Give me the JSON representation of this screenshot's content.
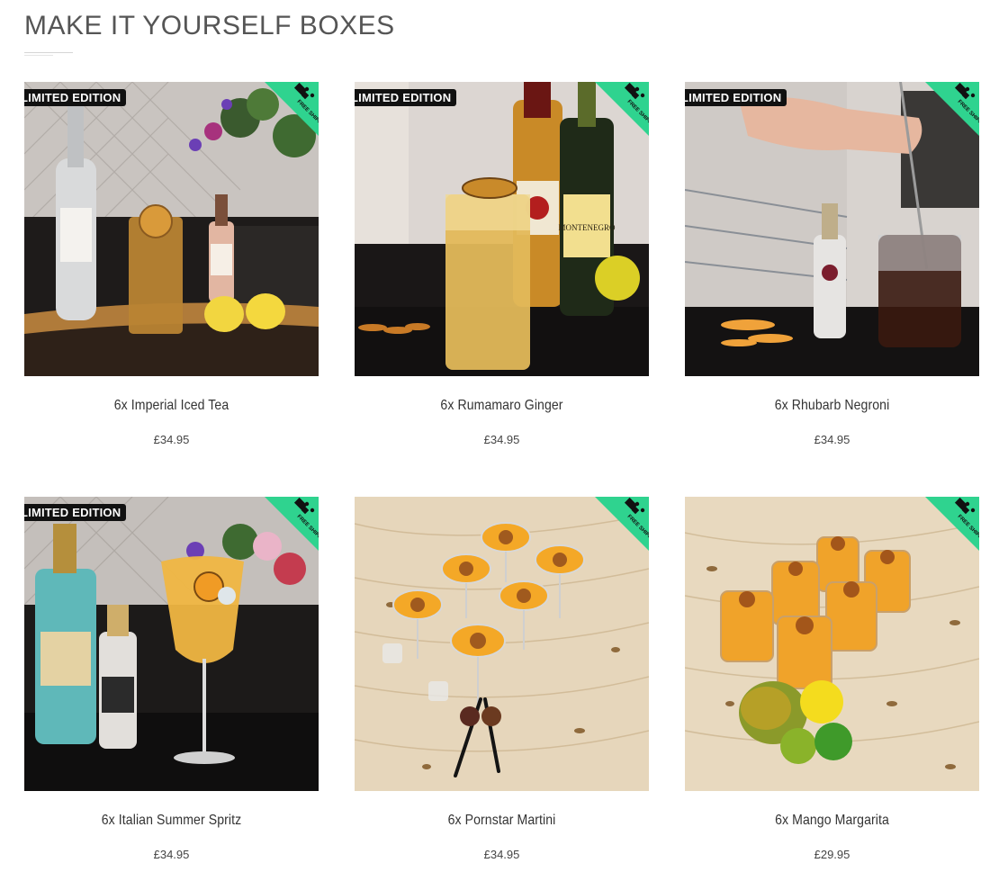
{
  "section": {
    "title": "MAKE IT YOURSELF BOXES"
  },
  "badges": {
    "limited": "LIMITED EDITION",
    "free_shipping": "FREE SHIPPING"
  },
  "products": [
    {
      "name": "6x Imperial Iced Tea",
      "price": "£34.95",
      "limited_edition": true,
      "free_shipping": true
    },
    {
      "name": "6x Rumamaro Ginger",
      "price": "£34.95",
      "limited_edition": true,
      "free_shipping": true
    },
    {
      "name": "6x Rhubarb Negroni",
      "price": "£34.95",
      "limited_edition": true,
      "free_shipping": true
    },
    {
      "name": "6x Italian Summer Spritz",
      "price": "£34.95",
      "limited_edition": true,
      "free_shipping": true
    },
    {
      "name": "6x Pornstar Martini",
      "price": "£34.95",
      "limited_edition": false,
      "free_shipping": true
    },
    {
      "name": "6x Mango Margarita",
      "price": "£29.95",
      "limited_edition": false,
      "free_shipping": true
    }
  ],
  "colors": {
    "ribbon_green": "#2fd38f",
    "badge_black": "#111111"
  }
}
